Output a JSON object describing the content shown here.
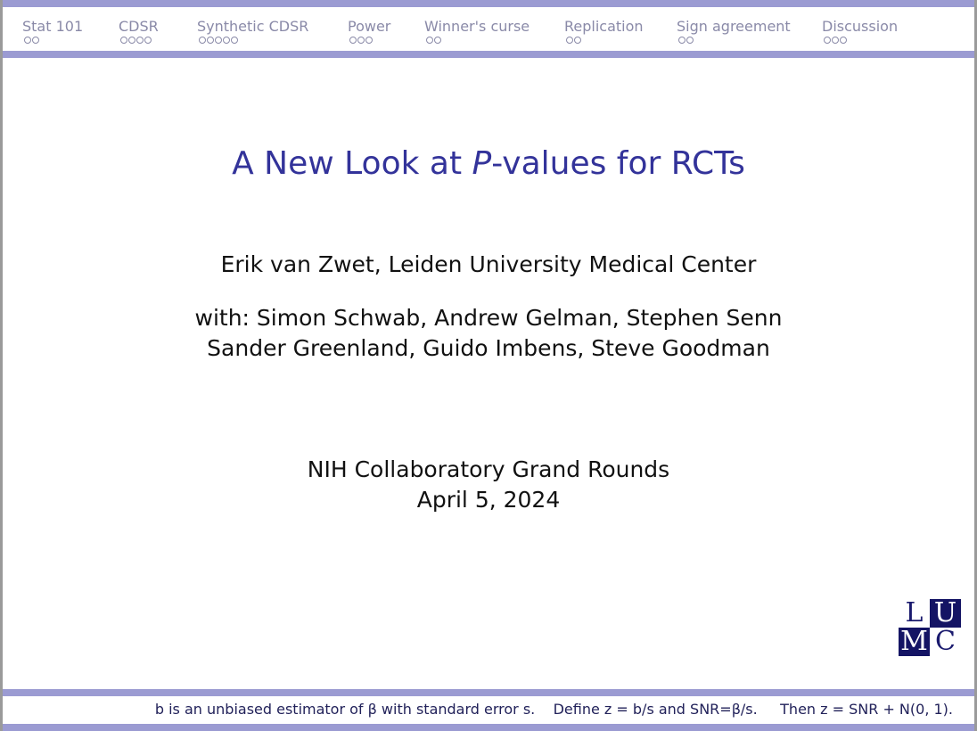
{
  "nav": {
    "sections": [
      {
        "label": "Stat 101",
        "slides": 2
      },
      {
        "label": "CDSR",
        "slides": 4
      },
      {
        "label": "Synthetic CDSR",
        "slides": 5
      },
      {
        "label": "Power",
        "slides": 3
      },
      {
        "label": "Winner's curse",
        "slides": 2
      },
      {
        "label": "Replication",
        "slides": 2
      },
      {
        "label": "Sign agreement",
        "slides": 2
      },
      {
        "label": "Discussion",
        "slides": 3
      }
    ]
  },
  "slide": {
    "title_pre": "A New Look at ",
    "title_italic": "P",
    "title_post": "-values for RCTs",
    "author": "Erik van Zwet, Leiden University Medical Center",
    "collaborators_line1": "with: Simon Schwab, Andrew Gelman, Stephen Senn",
    "collaborators_line2": "Sander Greenland, Guido Imbens, Steve Goodman",
    "event": "NIH Collaboratory Grand Rounds",
    "date": "April 5, 2024"
  },
  "logo": {
    "l": "L",
    "u": "U",
    "m": "M",
    "c": "C",
    "name": "LUMC"
  },
  "footer": {
    "text": "b is an unbiased estimator of β with standard error s.    Define z = b/s and SNR=β/s.     Then z = SNR + N(0, 1)."
  },
  "colors": {
    "accent_bar": "#9b9bd2",
    "title": "#33339a",
    "footer_text": "#22225a",
    "logo": "#141464"
  }
}
